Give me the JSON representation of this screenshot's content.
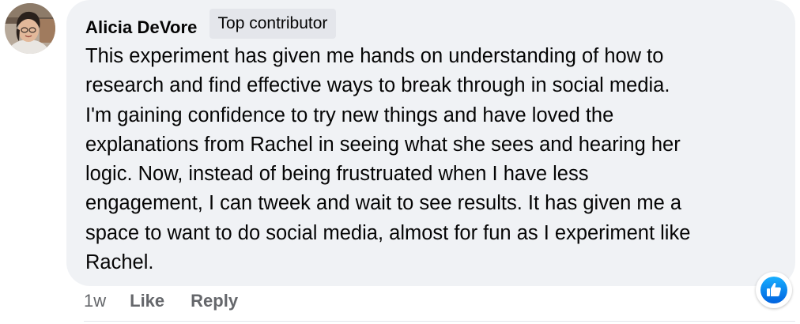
{
  "comment": {
    "author": "Alicia DeVore",
    "badge": "Top contributor",
    "text": "This experiment has given me hands on understanding of how to\nresearch and find effective ways to break through in social media.\nI'm gaining confidence to try new things and have loved the\nexplanations from Rachel in seeing what she sees and hearing her\nlogic. Now, instead of being frustruated when I have less\nengagement, I can tweek and wait to see results. It has given me a\nspace to want to do social media, almost for fun as I experiment like\nRachel.",
    "time": "1w",
    "like_label": "Like",
    "reply_label": "Reply",
    "reaction_icon": "like-reaction-icon"
  },
  "colors": {
    "bubble_bg": "#f0f2f5",
    "badge_bg": "#e4e6eb",
    "text": "#050505",
    "secondary_text": "#65676b",
    "like_blue": "#1877f2"
  }
}
